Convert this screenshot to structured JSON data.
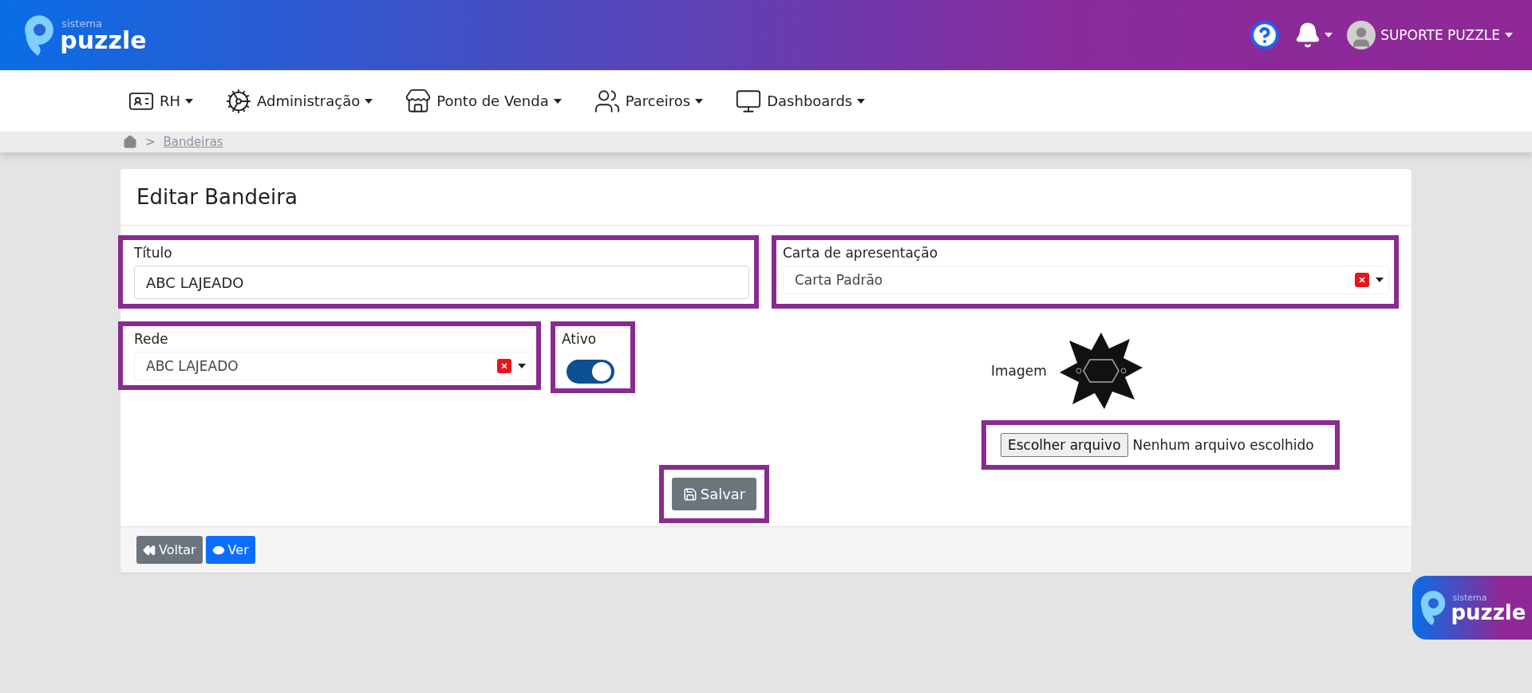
{
  "header": {
    "logo": {
      "small": "sistema",
      "big": "puzzle"
    },
    "user": "SUPORTE PUZZLE"
  },
  "nav": [
    {
      "label": "RH",
      "kind": "rh"
    },
    {
      "label": "Administração",
      "kind": "admin"
    },
    {
      "label": "Ponto de Venda",
      "kind": "store"
    },
    {
      "label": "Parceiros",
      "kind": "partners"
    },
    {
      "label": "Dashboards",
      "kind": "dashboards"
    }
  ],
  "breadcrumb": {
    "separator": ">",
    "current": "Bandeiras"
  },
  "card": {
    "title": "Editar Bandeira"
  },
  "titulo": {
    "label": "Título",
    "value": "ABC LAJEADO"
  },
  "carta": {
    "label": "Carta de apresentação",
    "value": "Carta Padrão"
  },
  "rede": {
    "label": "Rede",
    "value": "ABC LAJEADO"
  },
  "ativo": {
    "label": "Ativo",
    "on": true
  },
  "imagem": {
    "label": "Imagem",
    "file_button": "Escolher arquivo",
    "file_status": "Nenhum arquivo escolhido"
  },
  "save": "Salvar",
  "footer_buttons": [
    {
      "label": "Voltar",
      "kind": "back"
    },
    {
      "label": "Ver",
      "kind": "view"
    }
  ],
  "floating_logo": {
    "small": "sistema",
    "big": "puzzle"
  }
}
